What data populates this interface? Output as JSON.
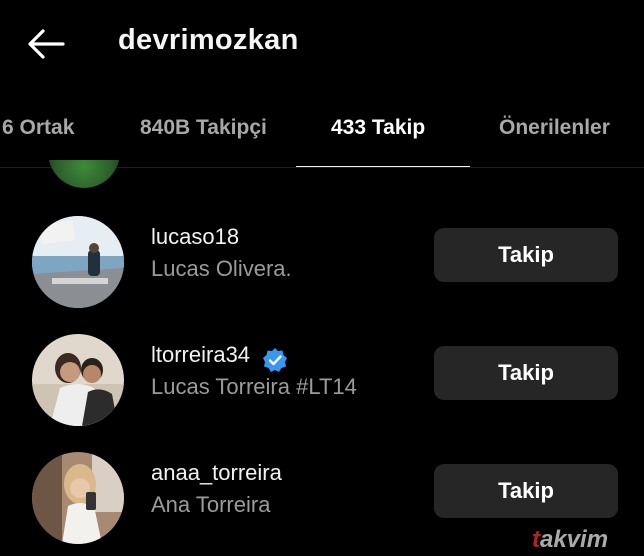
{
  "header": {
    "back_icon": "arrow-left-icon",
    "username": "devrimozkan"
  },
  "tabs": [
    {
      "label": "6 Ortak",
      "active": false
    },
    {
      "label": "840B Takipçi",
      "active": false
    },
    {
      "label": "433 Takip",
      "active": true
    },
    {
      "label": "Önerilenler",
      "active": false
    }
  ],
  "following": [
    {
      "username": "lucaso18",
      "full_name": "Lucas Olivera.",
      "verified": false,
      "button": "Takip"
    },
    {
      "username": "ltorreira34",
      "full_name": "Lucas Torreira #LT14",
      "verified": true,
      "button": "Takip"
    },
    {
      "username": "anaa_torreira",
      "full_name": "Ana Torreira",
      "verified": false,
      "button": "Takip"
    }
  ],
  "watermark": {
    "accent": "t",
    "text": "akvim"
  },
  "colors": {
    "background": "#000000",
    "button_bg": "#262626",
    "verified_badge": "#3897f0",
    "muted_text": "#9b9b9b"
  }
}
